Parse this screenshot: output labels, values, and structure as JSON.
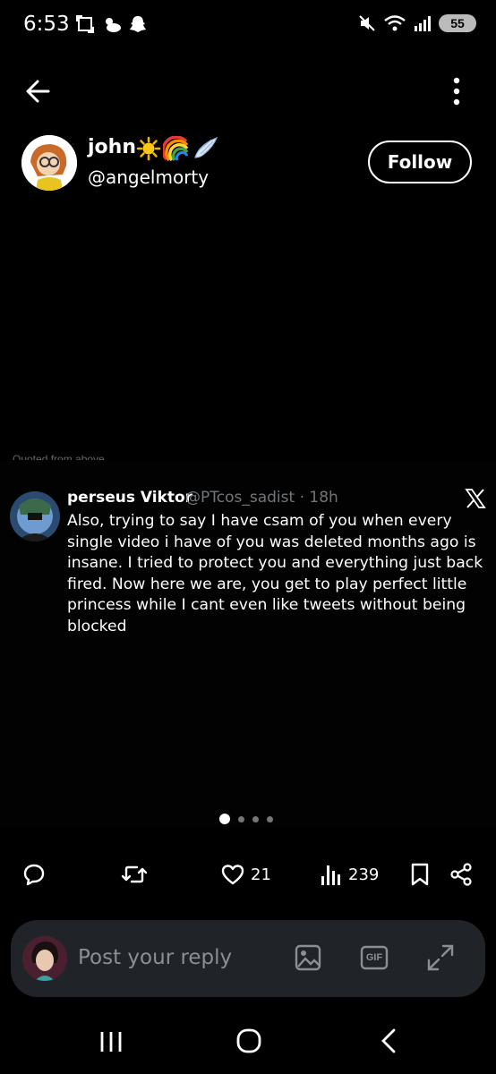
{
  "status_bar": {
    "time": "6:53",
    "battery": "55",
    "icons_left": [
      "screenshot-icon",
      "cloud-sun-icon",
      "snapchat-icon"
    ],
    "icons_right": [
      "mute-icon",
      "wifi-icon",
      "signal-icon",
      "battery-icon"
    ]
  },
  "header": {
    "back_icon": "arrow-left-icon",
    "more_icon": "vertical-dots-icon"
  },
  "profile": {
    "display_name": "john",
    "emojis": [
      "☀️",
      "🌈",
      "🪽"
    ],
    "handle": "@angelmorty",
    "follow_label": "Follow"
  },
  "tweet": {
    "author_name": "perseus Viktor",
    "author_handle": "@PTcos_sadist",
    "time": "18h",
    "meta": "@PTcos_sadist · 18h",
    "text": "Also, trying to say I have csam of you when every single video i have of you was deleted months ago is insane. I tried to protect you and everything just back fired. Now here we are, you get to play perfect little princess while I cant even like tweets without being blocked",
    "cut_caption": "Quoted from above",
    "carousel_pages": 4,
    "carousel_active": 1
  },
  "actions": {
    "reply_icon": "comment-icon",
    "retweet_icon": "retweet-icon",
    "like_icon": "heart-icon",
    "like_count": "21",
    "views_icon": "views-icon",
    "view_count": "239",
    "bookmark_icon": "bookmark-icon",
    "share_icon": "share-icon"
  },
  "reply_bar": {
    "placeholder": "Post your reply",
    "image_icon": "image-icon",
    "gif_label": "GIF",
    "expand_icon": "expand-icon"
  },
  "nav_bar": {
    "recents_icon": "recents-icon",
    "home_icon": "home-icon",
    "back_icon": "back-chevron-icon"
  },
  "colors": {
    "background": "#000000",
    "text": "#ffffff",
    "muted": "#71767b",
    "reply_bar": "#202327"
  }
}
